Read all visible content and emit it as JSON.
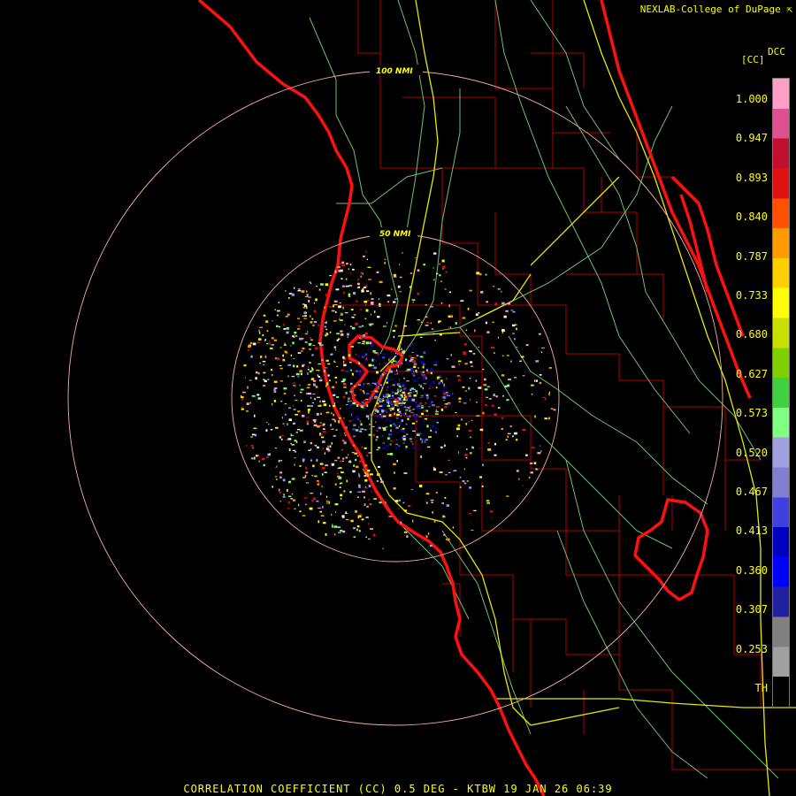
{
  "credit": "NEXLAB-College of DuPage",
  "credit_icon": "cursor-arrow-icon",
  "product_label": "CORRELATION COEFFICIENT (CC) 0.5 DEG - KTBW 19 JAN 26 06:39",
  "range_rings": [
    "50 NMI",
    "100 NMI"
  ],
  "legend": {
    "code": "DCC",
    "unit": "[CC]",
    "ticks": [
      "1.000",
      "0.947",
      "0.893",
      "0.840",
      "0.787",
      "0.733",
      "0.680",
      "0.627",
      "0.573",
      "0.520",
      "0.467",
      "0.413",
      "0.360",
      "0.307",
      "0.253",
      "TH"
    ],
    "colors": [
      "#ff9fc8",
      "#e05090",
      "#c01030",
      "#e01010",
      "#ff5000",
      "#ff9a00",
      "#ffd000",
      "#ffff00",
      "#c8e000",
      "#80d000",
      "#40d040",
      "#80ff80",
      "#a0a0e0",
      "#8080d0",
      "#4040e0",
      "#0000c0",
      "#0000ff",
      "#2020a0",
      "#808080",
      "#a0a0a0",
      "#000000"
    ]
  },
  "colors": {
    "coast": "#ff1010",
    "county": "#b00000",
    "roads_green": "#70c070",
    "roads_yellow": "#e8e800",
    "ring": "#f0b0a0",
    "text": "#ffff00"
  }
}
